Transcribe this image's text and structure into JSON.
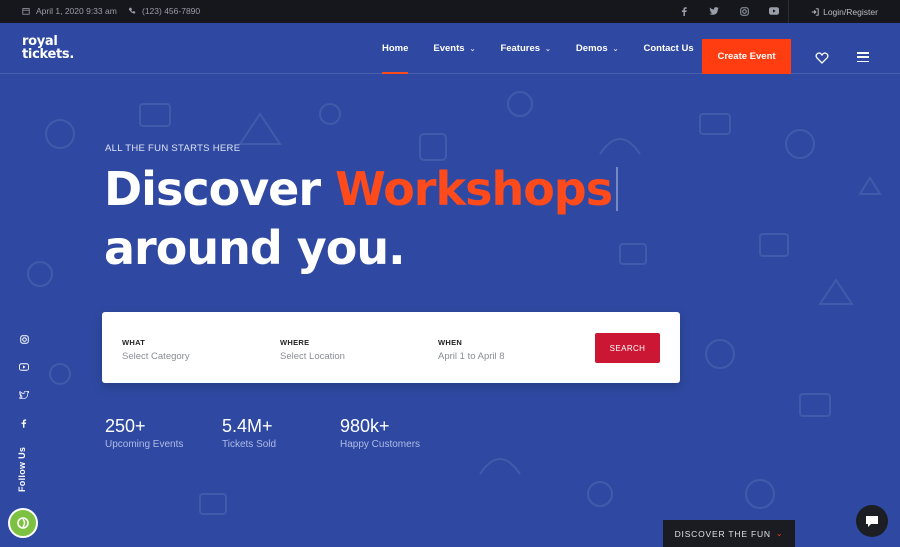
{
  "topbar": {
    "date": "April 1, 2020 9:33 am",
    "phone": "(123) 456-7890",
    "social": [
      "facebook-icon",
      "twitter-icon",
      "instagram-icon",
      "youtube-icon"
    ],
    "login": "Login/Register"
  },
  "nav": {
    "logo_line1": "royal",
    "logo_line2": "tickets.",
    "links": [
      {
        "label": "Home",
        "active": true
      },
      {
        "label": "Events",
        "dropdown": true
      },
      {
        "label": "Features",
        "dropdown": true
      },
      {
        "label": "Demos",
        "dropdown": true
      },
      {
        "label": "Contact Us"
      }
    ],
    "cta": "Create Event"
  },
  "hero": {
    "eyebrow": "ALL THE FUN STARTS HERE",
    "headline_part1": "Discover ",
    "headline_accent": "Workshops",
    "headline_line2": "around you."
  },
  "search": {
    "what_label": "WHAT",
    "what_value": "Select Category",
    "where_label": "WHERE",
    "where_value": "Select Location",
    "when_label": "WHEN",
    "when_value": "April 1 to April 8",
    "button": "SEARCH"
  },
  "stats": [
    {
      "num": "250+",
      "caption": "Upcoming Events"
    },
    {
      "num": "5.4M+",
      "caption": "Tickets Sold"
    },
    {
      "num": "980k+",
      "caption": "Happy Customers"
    }
  ],
  "rail": {
    "icons": [
      "instagram-icon",
      "youtube-icon",
      "twitter-icon",
      "facebook-icon"
    ],
    "label": "Follow Us"
  },
  "discover": "DISCOVER THE FUN",
  "colors": {
    "accent": "#ff4a1c",
    "hero_bg": "#2f49a2",
    "search_button": "#cc1734"
  }
}
